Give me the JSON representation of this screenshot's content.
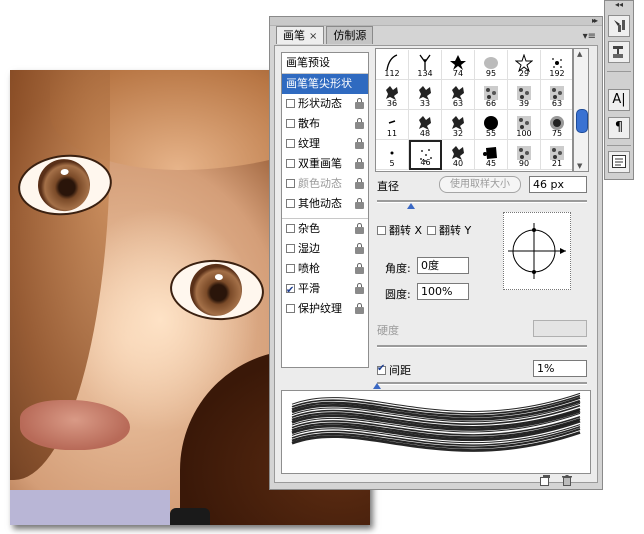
{
  "panel": {
    "tabs": [
      {
        "label": "画笔",
        "close": "×",
        "active": true
      },
      {
        "label": "仿制源",
        "active": false
      }
    ],
    "collapse_glyph": "▸▸",
    "menu_glyph": "▾≡"
  },
  "options": {
    "header": "画笔预设",
    "items": [
      {
        "label": "画笔笔尖形状",
        "selected": true,
        "checkbox": false,
        "lock": false
      },
      {
        "label": "形状动态",
        "checked": false,
        "lock": true
      },
      {
        "label": "散布",
        "checked": false,
        "lock": true
      },
      {
        "label": "纹理",
        "checked": false,
        "lock": true
      },
      {
        "label": "双重画笔",
        "checked": false,
        "lock": true
      },
      {
        "label": "颜色动态",
        "checked": false,
        "lock": true,
        "disabled": true
      },
      {
        "label": "其他动态",
        "checked": false,
        "lock": true
      },
      {
        "label": "杂色",
        "checked": false,
        "lock": true,
        "gap": true
      },
      {
        "label": "湿边",
        "checked": false,
        "lock": true
      },
      {
        "label": "喷枪",
        "checked": false,
        "lock": true
      },
      {
        "label": "平滑",
        "checked": true,
        "lock": true
      },
      {
        "label": "保护纹理",
        "checked": false,
        "lock": true
      }
    ]
  },
  "presets": [
    {
      "size": "112",
      "shape": "stroke"
    },
    {
      "size": "134",
      "shape": "grass"
    },
    {
      "size": "74",
      "shape": "leaf"
    },
    {
      "size": "95",
      "shape": "blob"
    },
    {
      "size": "29",
      "shape": "star"
    },
    {
      "size": "192",
      "shape": "spray"
    },
    {
      "size": "36",
      "shape": "scatter"
    },
    {
      "size": "33",
      "shape": "scatter"
    },
    {
      "size": "63",
      "shape": "scatter"
    },
    {
      "size": "66",
      "shape": "texture"
    },
    {
      "size": "39",
      "shape": "texture"
    },
    {
      "size": "63",
      "shape": "texture"
    },
    {
      "size": "11",
      "shape": "dash"
    },
    {
      "size": "48",
      "shape": "scatter"
    },
    {
      "size": "32",
      "shape": "scatter"
    },
    {
      "size": "55",
      "shape": "round-hard"
    },
    {
      "size": "100",
      "shape": "texture"
    },
    {
      "size": "75",
      "shape": "round-soft"
    },
    {
      "size": "5",
      "shape": "dot"
    },
    {
      "size": "46",
      "shape": "noise",
      "selected": true
    },
    {
      "size": "40",
      "shape": "scatter"
    },
    {
      "size": "45",
      "shape": "splat"
    },
    {
      "size": "90",
      "shape": "texture"
    },
    {
      "size": "21",
      "shape": "texture"
    }
  ],
  "controls": {
    "diameter_label": "直径",
    "sample_button": "使用取样大小",
    "diameter_value": "46 px",
    "diameter_fraction": 0.16,
    "flip_x_label": "翻转 X",
    "flip_y_label": "翻转 Y",
    "flip_x": false,
    "flip_y": false,
    "angle_label": "角度:",
    "angle_value": "0度",
    "roundness_label": "圆度:",
    "roundness_value": "100%",
    "hardness_label": "硬度",
    "spacing_label": "间距",
    "spacing_checked": true,
    "spacing_value": "1%",
    "spacing_fraction": 0.0
  },
  "footer": {
    "new_icon": "new-preset-icon",
    "trash_icon": "trash-icon"
  },
  "dock": {
    "arrow_glyph": "◂◂",
    "text_tool_glyph": "A|",
    "paragraph_glyph": "¶"
  },
  "colors": {
    "selection_blue": "#2f6ac0",
    "slider_blue": "#3a68c4",
    "panel_gray": "#d4d4d4"
  }
}
